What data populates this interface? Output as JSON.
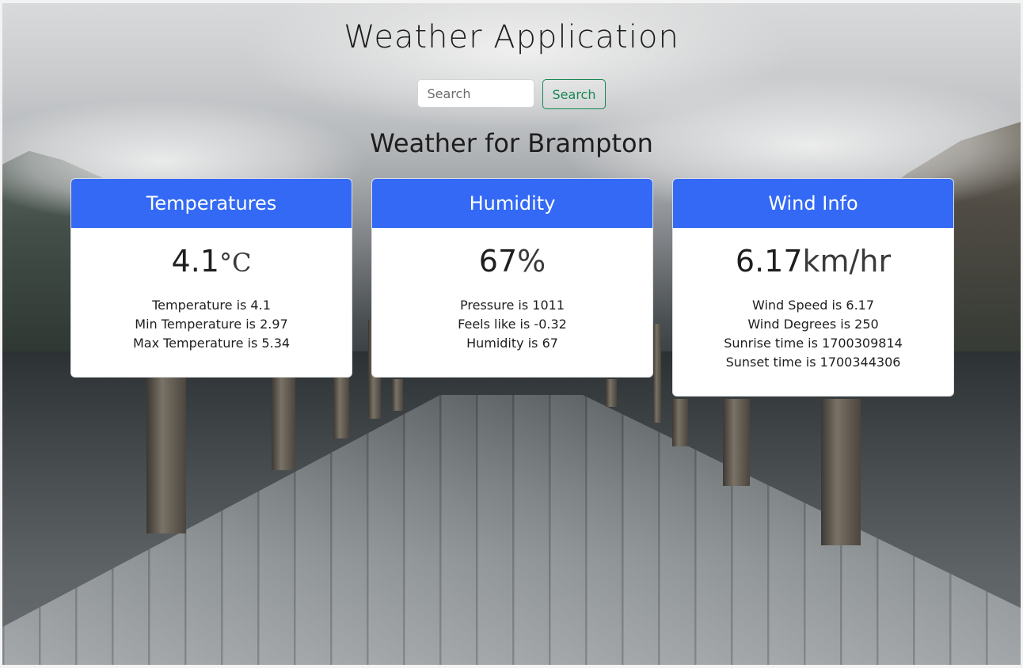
{
  "app": {
    "title": "Weather Application"
  },
  "search": {
    "placeholder": "Search",
    "button_label": "Search"
  },
  "location": {
    "heading": "Weather for Brampton"
  },
  "colors": {
    "header_bg": "#3369f5",
    "search_button": "#198754"
  },
  "cards": {
    "temperatures": {
      "title": "Temperatures",
      "value": "4.1",
      "unit": "°C",
      "lines": [
        "Temperature is 4.1",
        "Min Temperature is 2.97",
        "Max Temperature is 5.34"
      ]
    },
    "humidity": {
      "title": "Humidity",
      "value": "67",
      "unit": "%",
      "lines": [
        "Pressure is 1011",
        "Feels like is -0.32",
        "Humidity is 67"
      ]
    },
    "wind": {
      "title": "Wind Info",
      "value": "6.17",
      "unit": "km/hr",
      "lines": [
        "Wind Speed is 6.17",
        "Wind Degrees is 250",
        "Sunrise time is 1700309814",
        "Sunset time is 1700344306"
      ]
    }
  }
}
